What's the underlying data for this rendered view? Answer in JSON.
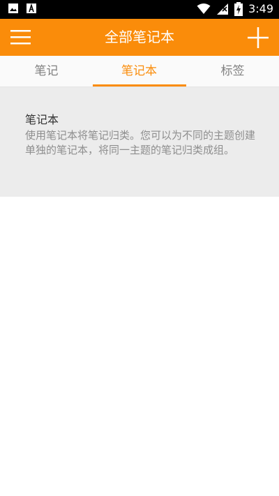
{
  "status_bar": {
    "time": "3:49",
    "left_icons": [
      "image-icon",
      "font-icon"
    ],
    "right_icons": [
      "wifi-icon",
      "signal-icon",
      "battery-charging-icon"
    ]
  },
  "app_bar": {
    "title": "全部笔记本",
    "menu_icon": "menu-icon",
    "add_icon": "plus-icon",
    "color": "#fa8c0a"
  },
  "tabs": [
    {
      "label": "笔记",
      "active": false
    },
    {
      "label": "笔记本",
      "active": true
    },
    {
      "label": "标签",
      "active": false
    }
  ],
  "info": {
    "title": "笔记本",
    "description": "使用笔记本将笔记归类。您可以为不同的主题创建单独的笔记本，将同一主题的笔记归类成组。"
  }
}
